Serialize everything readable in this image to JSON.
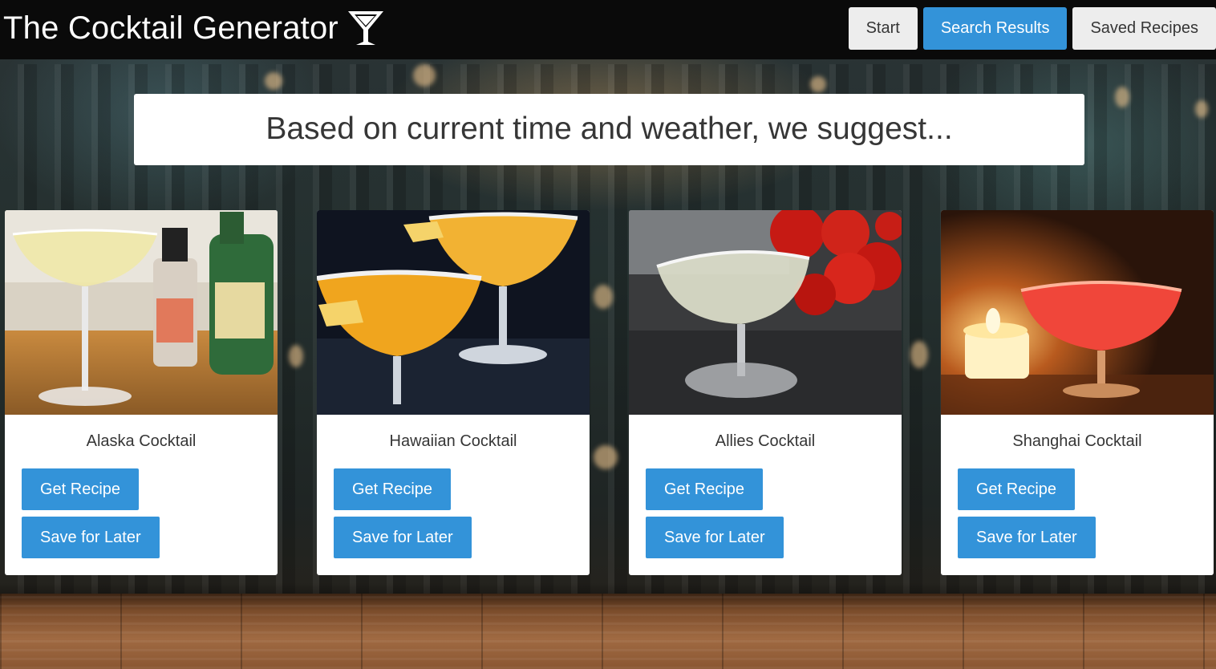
{
  "header": {
    "title": "The Cocktail Generator",
    "icon": "martini-glass-icon",
    "nav": {
      "start_label": "Start",
      "search_results_label": "Search Results",
      "saved_recipes_label": "Saved Recipes"
    }
  },
  "banner": {
    "text": "Based on current time and weather, we suggest..."
  },
  "cocktails": [
    {
      "name": "Alaska Cocktail",
      "get_recipe_label": "Get Recipe",
      "save_label": "Save for Later"
    },
    {
      "name": "Hawaiian Cocktail",
      "get_recipe_label": "Get Recipe",
      "save_label": "Save for Later"
    },
    {
      "name": "Allies Cocktail",
      "get_recipe_label": "Get Recipe",
      "save_label": "Save for Later"
    },
    {
      "name": "Shanghai Cocktail",
      "get_recipe_label": "Get Recipe",
      "save_label": "Save for Later"
    }
  ],
  "colors": {
    "header_bg": "#0a0a0a",
    "primary_button": "#3393d9",
    "light_button": "#ededed",
    "text_dark": "#363636"
  }
}
